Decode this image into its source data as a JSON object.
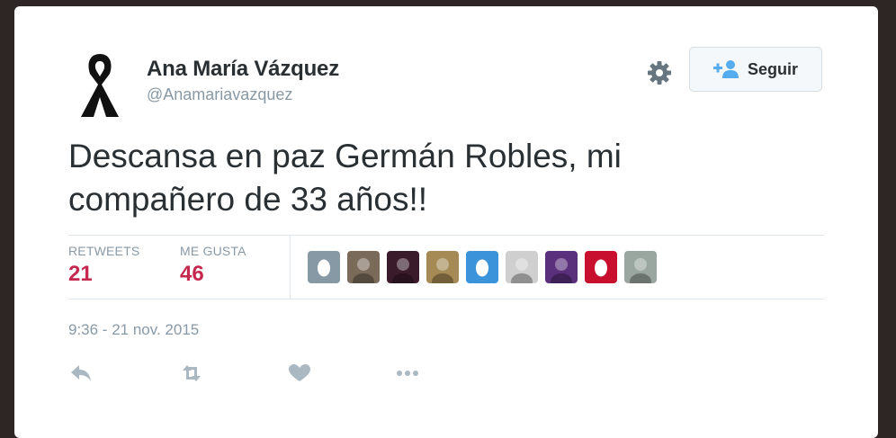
{
  "user": {
    "name": "Ana María Vázquez",
    "handle": "@Anamariavazquez",
    "avatar_icon": "black-ribbon-icon"
  },
  "header": {
    "settings_icon": "gear-icon",
    "follow_label": "Seguir",
    "follow_icon": "add-user-icon"
  },
  "tweet": {
    "line1": "Descansa en paz Germán Robles, mi",
    "line2": "compañero de 33 años!!"
  },
  "stats": {
    "retweets_label": "RETWEETS",
    "retweets_value": "21",
    "likes_label": "ME GUSTA",
    "likes_value": "46"
  },
  "likers": [
    {
      "kind": "egg",
      "color": "#8899a6"
    },
    {
      "kind": "photo",
      "color": "#7a6a5a"
    },
    {
      "kind": "photo",
      "color": "#3a1b2b"
    },
    {
      "kind": "photo",
      "color": "#a58a55"
    },
    {
      "kind": "egg",
      "color": "#3b94d9"
    },
    {
      "kind": "photo",
      "color": "#cfcfcf"
    },
    {
      "kind": "photo",
      "color": "#5a2f7c"
    },
    {
      "kind": "egg",
      "color": "#c8102e"
    },
    {
      "kind": "photo",
      "color": "#9aa7a0"
    }
  ],
  "timestamp": "9:36 - 21 nov. 2015",
  "actions": [
    "reply-icon",
    "retweet-icon",
    "like-icon",
    "more-icon"
  ],
  "colors": {
    "accent": "#c5284e",
    "muted": "#8899a6",
    "text": "#292f33",
    "follow_icon": "#55acee"
  }
}
